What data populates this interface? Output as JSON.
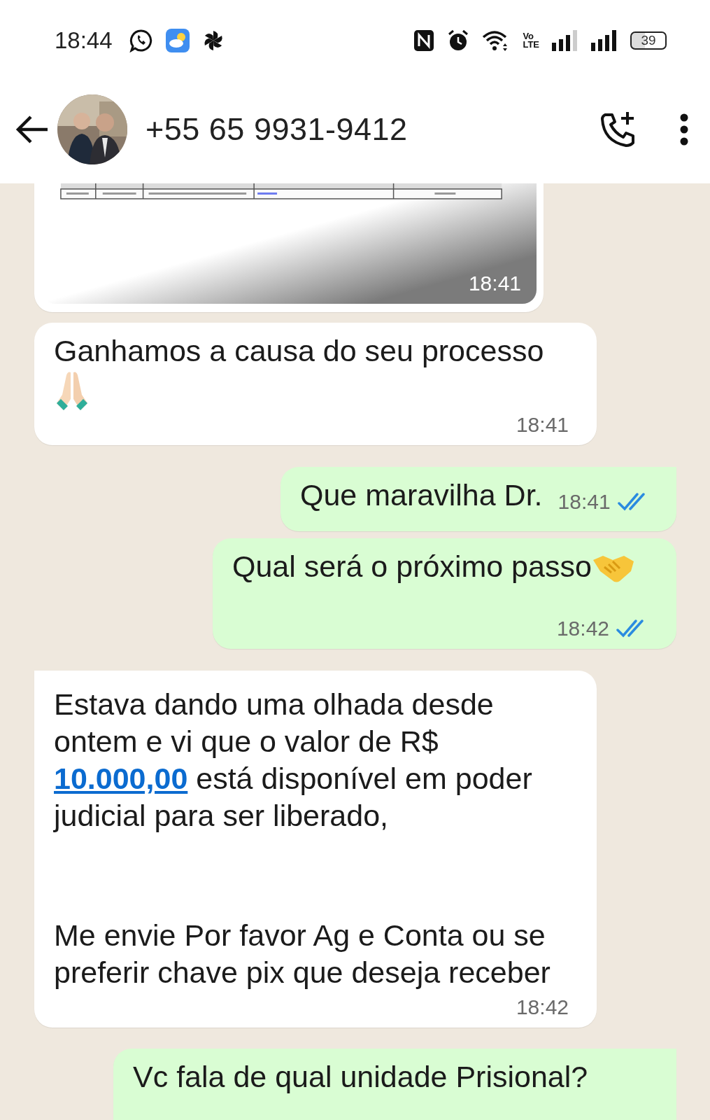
{
  "status_bar": {
    "time": "18:44",
    "volte": {
      "top": "Vo",
      "bottom": "LTE"
    },
    "battery": "39"
  },
  "chat_header": {
    "contact": "+55 65 9931-9412"
  },
  "messages": [
    {
      "outgoing": false,
      "time": "18:41"
    },
    {
      "kind": "text",
      "outgoing": false,
      "inline_time": false,
      "paragraphs": [
        [
          {
            "kind": "text",
            "text": "Ganhamos a causa do seu processo"
          },
          {
            "kind": "praying-hands"
          }
        ]
      ],
      "time": "18:41"
    },
    {
      "kind": "text",
      "outgoing": true,
      "inline_time": true,
      "paragraphs": [
        [
          {
            "kind": "text",
            "text": "Que maravilha Dr."
          }
        ]
      ],
      "time": "18:41",
      "read": true
    },
    {
      "kind": "text",
      "outgoing": true,
      "inline_time": false,
      "paragraphs": [
        [
          {
            "kind": "text",
            "text": "Qual será o próximo passo"
          },
          {
            "kind": "handshake"
          }
        ]
      ],
      "time": "18:42",
      "read": true
    },
    {
      "kind": "text",
      "outgoing": false,
      "inline_time": false,
      "paragraphs": [
        [
          {
            "kind": "text",
            "text": "Estava dando uma olhada desde ontem e vi que o valor de R$ "
          },
          {
            "kind": "link",
            "text": "10.000,00"
          },
          {
            "kind": "text",
            "text": " está disponível em poder judicial para ser liberado,"
          }
        ],
        [
          {
            "kind": "text",
            "text": "Me envie Por favor Ag e Conta ou se preferir chave pix que deseja receber"
          }
        ]
      ],
      "time": "18:42"
    },
    {
      "kind": "text",
      "outgoing": true,
      "inline_time": false,
      "paragraphs": [
        [
          {
            "kind": "text",
            "text": "Vc fala de qual unidade Prisional?"
          }
        ]
      ]
    }
  ]
}
